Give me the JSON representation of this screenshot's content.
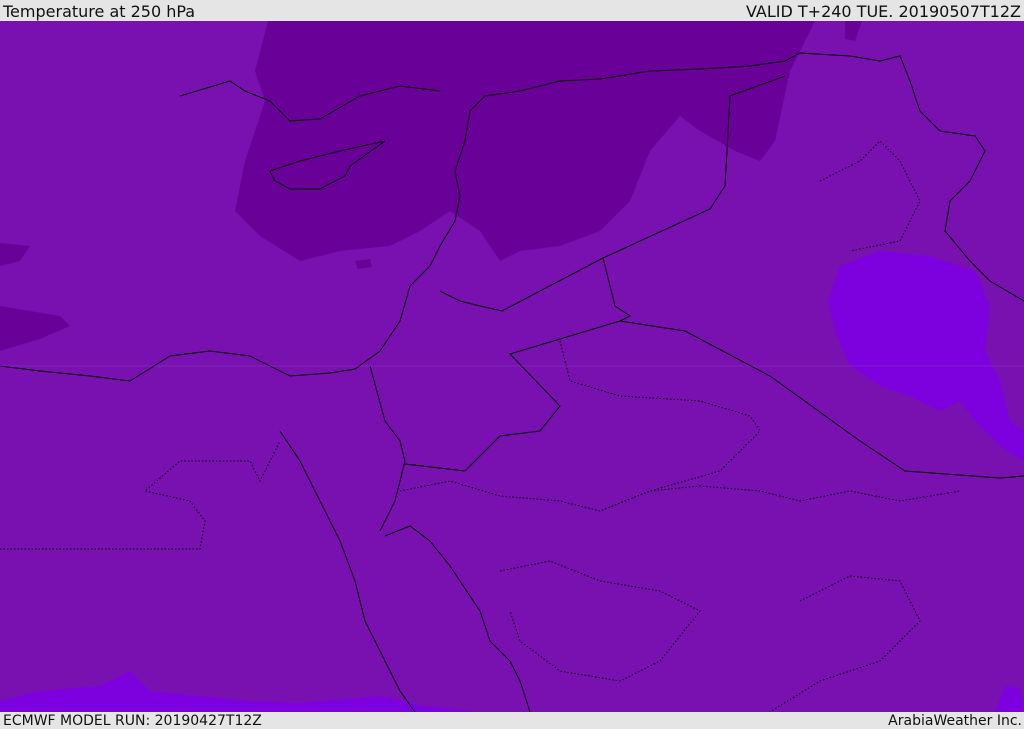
{
  "header": {
    "title": "Temperature at 250 hPa",
    "valid": "VALID T+240 TUE. 20190507T12Z"
  },
  "footer": {
    "model_run": "ECMWF MODEL RUN: 20190427T12Z",
    "credit": "ArabiaWeather Inc."
  },
  "colors": {
    "base": "#7811b0",
    "cold": "#690098",
    "warm": "#7d00df",
    "border": "#000000"
  }
}
